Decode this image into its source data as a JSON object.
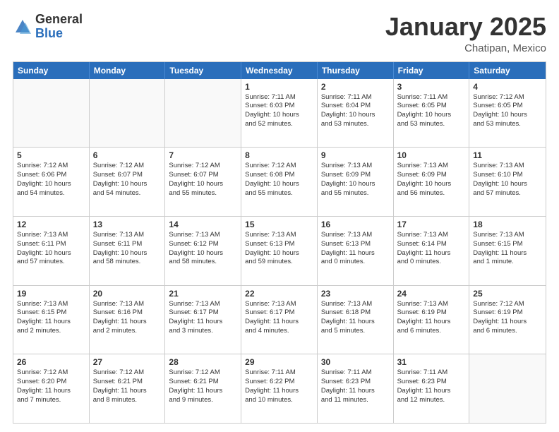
{
  "header": {
    "logo_general": "General",
    "logo_blue": "Blue",
    "month_title": "January 2025",
    "location": "Chatipan, Mexico"
  },
  "weekdays": [
    "Sunday",
    "Monday",
    "Tuesday",
    "Wednesday",
    "Thursday",
    "Friday",
    "Saturday"
  ],
  "rows": [
    [
      {
        "day": "",
        "text": ""
      },
      {
        "day": "",
        "text": ""
      },
      {
        "day": "",
        "text": ""
      },
      {
        "day": "1",
        "text": "Sunrise: 7:11 AM\nSunset: 6:03 PM\nDaylight: 10 hours\nand 52 minutes."
      },
      {
        "day": "2",
        "text": "Sunrise: 7:11 AM\nSunset: 6:04 PM\nDaylight: 10 hours\nand 53 minutes."
      },
      {
        "day": "3",
        "text": "Sunrise: 7:11 AM\nSunset: 6:05 PM\nDaylight: 10 hours\nand 53 minutes."
      },
      {
        "day": "4",
        "text": "Sunrise: 7:12 AM\nSunset: 6:05 PM\nDaylight: 10 hours\nand 53 minutes."
      }
    ],
    [
      {
        "day": "5",
        "text": "Sunrise: 7:12 AM\nSunset: 6:06 PM\nDaylight: 10 hours\nand 54 minutes."
      },
      {
        "day": "6",
        "text": "Sunrise: 7:12 AM\nSunset: 6:07 PM\nDaylight: 10 hours\nand 54 minutes."
      },
      {
        "day": "7",
        "text": "Sunrise: 7:12 AM\nSunset: 6:07 PM\nDaylight: 10 hours\nand 55 minutes."
      },
      {
        "day": "8",
        "text": "Sunrise: 7:12 AM\nSunset: 6:08 PM\nDaylight: 10 hours\nand 55 minutes."
      },
      {
        "day": "9",
        "text": "Sunrise: 7:13 AM\nSunset: 6:09 PM\nDaylight: 10 hours\nand 55 minutes."
      },
      {
        "day": "10",
        "text": "Sunrise: 7:13 AM\nSunset: 6:09 PM\nDaylight: 10 hours\nand 56 minutes."
      },
      {
        "day": "11",
        "text": "Sunrise: 7:13 AM\nSunset: 6:10 PM\nDaylight: 10 hours\nand 57 minutes."
      }
    ],
    [
      {
        "day": "12",
        "text": "Sunrise: 7:13 AM\nSunset: 6:11 PM\nDaylight: 10 hours\nand 57 minutes."
      },
      {
        "day": "13",
        "text": "Sunrise: 7:13 AM\nSunset: 6:11 PM\nDaylight: 10 hours\nand 58 minutes."
      },
      {
        "day": "14",
        "text": "Sunrise: 7:13 AM\nSunset: 6:12 PM\nDaylight: 10 hours\nand 58 minutes."
      },
      {
        "day": "15",
        "text": "Sunrise: 7:13 AM\nSunset: 6:13 PM\nDaylight: 10 hours\nand 59 minutes."
      },
      {
        "day": "16",
        "text": "Sunrise: 7:13 AM\nSunset: 6:13 PM\nDaylight: 11 hours\nand 0 minutes."
      },
      {
        "day": "17",
        "text": "Sunrise: 7:13 AM\nSunset: 6:14 PM\nDaylight: 11 hours\nand 0 minutes."
      },
      {
        "day": "18",
        "text": "Sunrise: 7:13 AM\nSunset: 6:15 PM\nDaylight: 11 hours\nand 1 minute."
      }
    ],
    [
      {
        "day": "19",
        "text": "Sunrise: 7:13 AM\nSunset: 6:15 PM\nDaylight: 11 hours\nand 2 minutes."
      },
      {
        "day": "20",
        "text": "Sunrise: 7:13 AM\nSunset: 6:16 PM\nDaylight: 11 hours\nand 2 minutes."
      },
      {
        "day": "21",
        "text": "Sunrise: 7:13 AM\nSunset: 6:17 PM\nDaylight: 11 hours\nand 3 minutes."
      },
      {
        "day": "22",
        "text": "Sunrise: 7:13 AM\nSunset: 6:17 PM\nDaylight: 11 hours\nand 4 minutes."
      },
      {
        "day": "23",
        "text": "Sunrise: 7:13 AM\nSunset: 6:18 PM\nDaylight: 11 hours\nand 5 minutes."
      },
      {
        "day": "24",
        "text": "Sunrise: 7:13 AM\nSunset: 6:19 PM\nDaylight: 11 hours\nand 6 minutes."
      },
      {
        "day": "25",
        "text": "Sunrise: 7:12 AM\nSunset: 6:19 PM\nDaylight: 11 hours\nand 6 minutes."
      }
    ],
    [
      {
        "day": "26",
        "text": "Sunrise: 7:12 AM\nSunset: 6:20 PM\nDaylight: 11 hours\nand 7 minutes."
      },
      {
        "day": "27",
        "text": "Sunrise: 7:12 AM\nSunset: 6:21 PM\nDaylight: 11 hours\nand 8 minutes."
      },
      {
        "day": "28",
        "text": "Sunrise: 7:12 AM\nSunset: 6:21 PM\nDaylight: 11 hours\nand 9 minutes."
      },
      {
        "day": "29",
        "text": "Sunrise: 7:11 AM\nSunset: 6:22 PM\nDaylight: 11 hours\nand 10 minutes."
      },
      {
        "day": "30",
        "text": "Sunrise: 7:11 AM\nSunset: 6:23 PM\nDaylight: 11 hours\nand 11 minutes."
      },
      {
        "day": "31",
        "text": "Sunrise: 7:11 AM\nSunset: 6:23 PM\nDaylight: 11 hours\nand 12 minutes."
      },
      {
        "day": "",
        "text": ""
      }
    ]
  ]
}
